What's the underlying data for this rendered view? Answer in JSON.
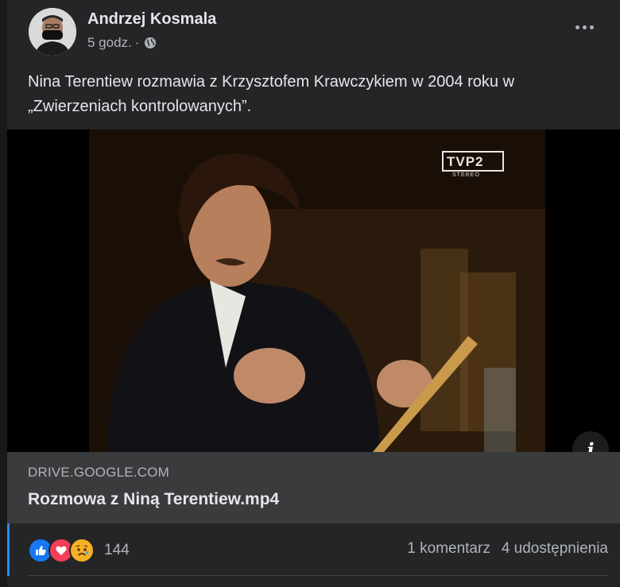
{
  "post": {
    "author": "Andrzej Kosmala",
    "time": "5 godz.",
    "separator": "·",
    "privacy_icon": "globe-icon",
    "text": "Nina Terentiew rozmawia z Krzysztofem Krawczykiem w 2004 roku w „Zwierzeniach kontrolowanych”.",
    "more_icon": "more-dots-icon"
  },
  "video": {
    "channel_logo": "TVP2",
    "channel_sub": "STEREO",
    "info_icon": "info-icon",
    "info_glyph": "i"
  },
  "link": {
    "domain": "DRIVE.GOOGLE.COM",
    "title": "Rozmowa z Niną Terentiew.mp4"
  },
  "footer": {
    "reaction_icons": [
      "like-icon",
      "love-icon",
      "sad-icon"
    ],
    "reaction_count": "144",
    "comments": "1 komentarz",
    "shares": "4 udostępnienia"
  },
  "colors": {
    "background": "#18191a",
    "card": "#242526",
    "link_box": "#3a3b3c",
    "accent": "#2d88ff",
    "like": "#1877f2",
    "love": "#f33e58",
    "sad": "#f7b125"
  }
}
